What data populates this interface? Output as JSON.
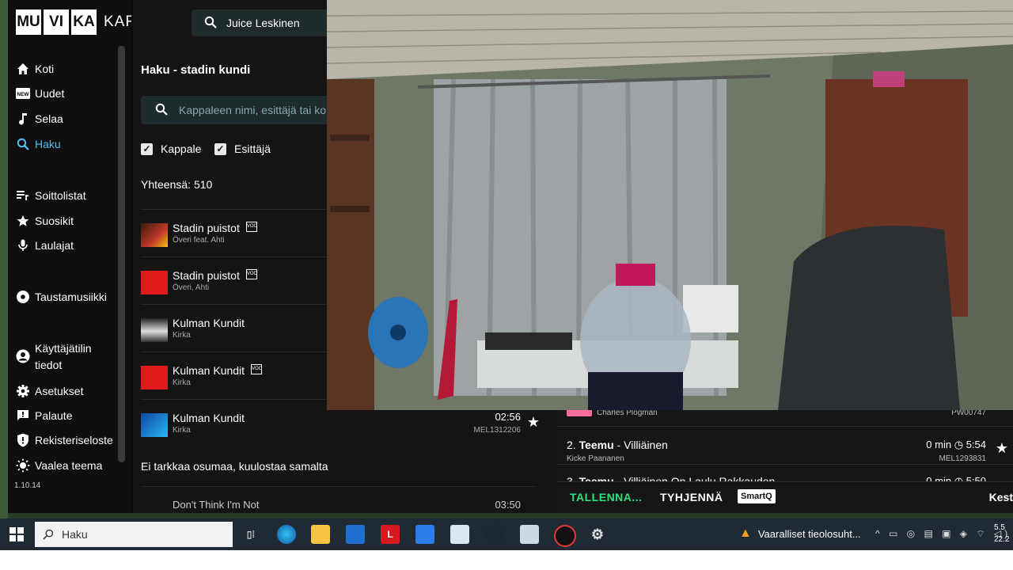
{
  "app": {
    "logo_boxes": [
      "MU",
      "VI",
      "KA"
    ],
    "logo_text": "KARAOKE",
    "top_search_value": "Juice Leskinen",
    "version": "1.10.14"
  },
  "sidebar": {
    "items": [
      {
        "label": "Koti",
        "icon": "home-icon"
      },
      {
        "label": "Uudet",
        "icon": "new-icon"
      },
      {
        "label": "Selaa",
        "icon": "music-note-icon"
      },
      {
        "label": "Haku",
        "icon": "search-icon"
      },
      {
        "label": "Soittolistat",
        "icon": "playlist-icon"
      },
      {
        "label": "Suosikit",
        "icon": "star-icon"
      },
      {
        "label": "Laulajat",
        "icon": "microphone-icon"
      },
      {
        "label": "Taustamusiikki",
        "icon": "disc-icon"
      },
      {
        "label": "Käyttäjätilin",
        "icon": "account-icon"
      },
      {
        "label": "tiedot",
        "icon": ""
      },
      {
        "label": "Asetukset",
        "icon": "gear-icon"
      },
      {
        "label": "Palaute",
        "icon": "feedback-icon"
      },
      {
        "label": "Rekisteriseloste",
        "icon": "shield-icon"
      },
      {
        "label": "Vaalea teema",
        "icon": "sun-icon"
      }
    ]
  },
  "search": {
    "title": "Haku - stadin kundi",
    "placeholder": "Kappaleen nimi, esittäjä tai ko",
    "filters": [
      {
        "label": "Kappale",
        "checked": true
      },
      {
        "label": "Esittäjä",
        "checked": true
      }
    ],
    "total": "Yhteensä: 510",
    "results": [
      {
        "title": "Stadin puistot",
        "artist": "Överi feat. Ahti",
        "voc": true,
        "duration": "",
        "code": ""
      },
      {
        "title": "Stadin puistot",
        "artist": "Överi, Ahti",
        "voc": true,
        "duration": "",
        "code": ""
      },
      {
        "title": "Kulman Kundit",
        "artist": "Kirka",
        "voc": false,
        "duration": "",
        "code": ""
      },
      {
        "title": "Kulman Kundit",
        "artist": "Kirka",
        "voc": true,
        "duration": "",
        "code": ""
      },
      {
        "title": "Kulman Kundit",
        "artist": "Kirka",
        "voc": false,
        "duration": "02:56",
        "code": "MEL1312206"
      }
    ],
    "no_exact": "Ei tarkkaa osumaa, kuulostaa samalta",
    "partial_row": {
      "title": "Don't Think I'm Not",
      "duration": "03:50"
    }
  },
  "queue": {
    "partial_artist": "Charles Plogman",
    "partial_code": "PW00747",
    "items": [
      {
        "num": "2.",
        "singer": "Teemu",
        "song": "Villiäinen",
        "artist": "Kicke Paananen",
        "wait": "0 min",
        "length": "5:54",
        "code": "MEL1293831"
      },
      {
        "num": "3.",
        "singer": "Teemu",
        "song": "Villiäinen On Laulu Rakkauden",
        "artist": "",
        "wait": "0 min",
        "length": "5:50",
        "code": ""
      }
    ],
    "save": "TALLENNA...",
    "clear": "TYHJENNÄ",
    "smartq": "SmartQ",
    "kest": "Kest"
  },
  "taskbar": {
    "search_label": "Haku",
    "warning": "Vaaralliset tieolosuht...",
    "time": "5.5",
    "date": "22.2"
  },
  "colors": {
    "accent": "#4fc3f7",
    "save_green": "#2ee07a",
    "background": "#121212"
  }
}
